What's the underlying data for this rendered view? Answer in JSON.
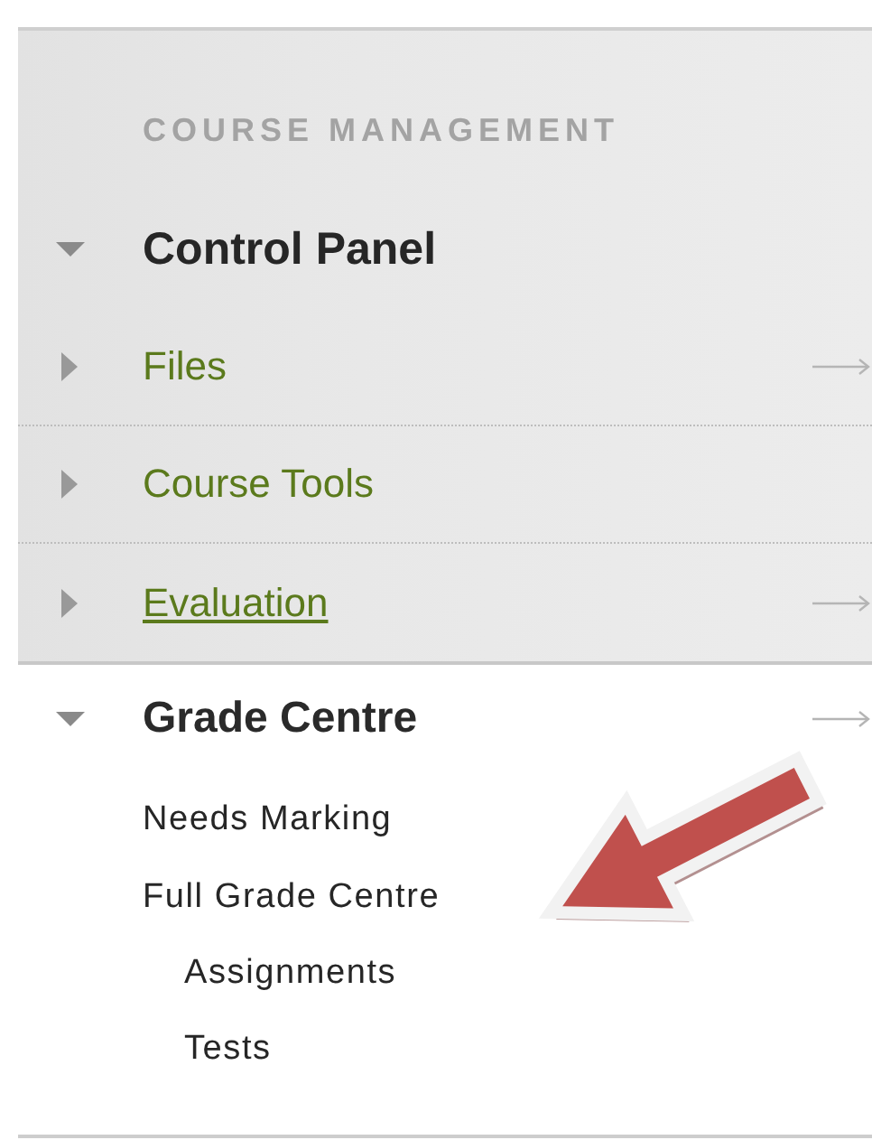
{
  "panel": {
    "heading": "COURSE MANAGEMENT",
    "title": "Control Panel",
    "expanded": true,
    "items": [
      {
        "label": "Files",
        "expanded": false,
        "underlined": false,
        "go_arrow": true
      },
      {
        "label": "Course Tools",
        "expanded": false,
        "underlined": false,
        "go_arrow": false
      },
      {
        "label": "Evaluation",
        "expanded": false,
        "underlined": true,
        "go_arrow": true
      }
    ]
  },
  "grade_centre": {
    "title": "Grade Centre",
    "expanded": true,
    "go_arrow": true,
    "links": [
      {
        "label": "Needs Marking"
      },
      {
        "label": "Full Grade Centre",
        "children": [
          {
            "label": "Assignments"
          },
          {
            "label": "Tests"
          }
        ]
      }
    ]
  }
}
